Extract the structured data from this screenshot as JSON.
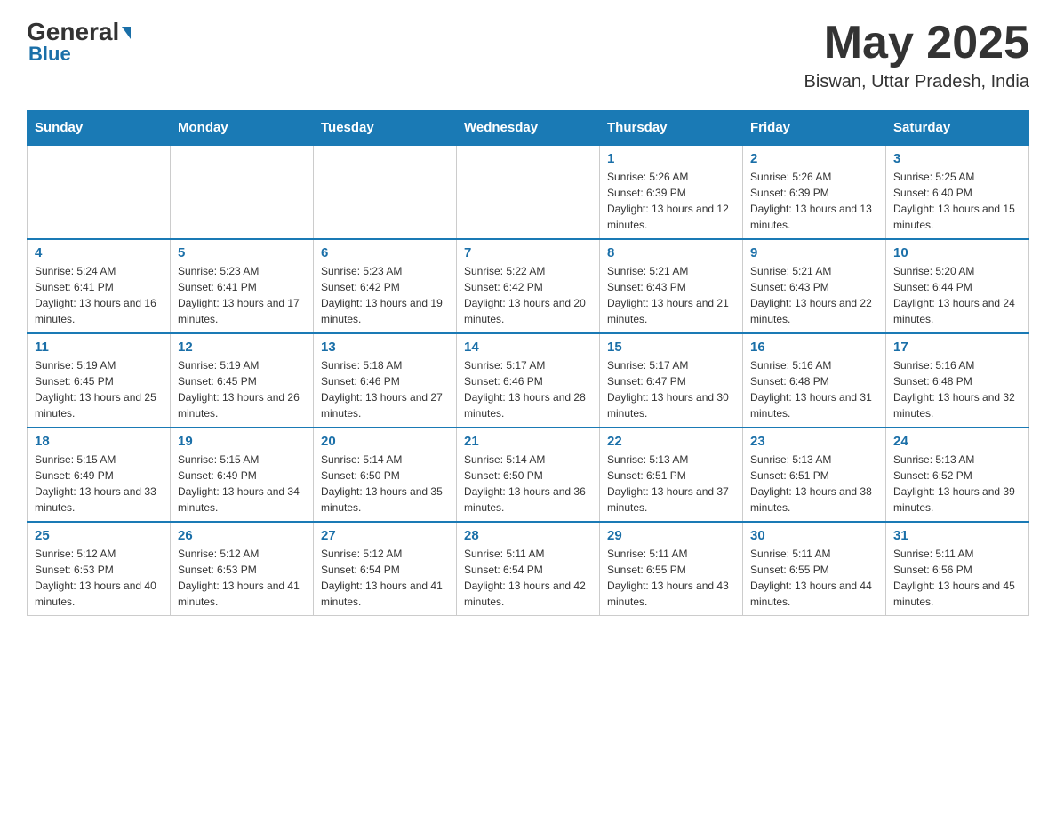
{
  "header": {
    "logo_general": "General",
    "logo_blue": "Blue",
    "title": "May 2025",
    "location": "Biswan, Uttar Pradesh, India"
  },
  "weekdays": [
    "Sunday",
    "Monday",
    "Tuesday",
    "Wednesday",
    "Thursday",
    "Friday",
    "Saturday"
  ],
  "weeks": [
    [
      {
        "day": "",
        "info": ""
      },
      {
        "day": "",
        "info": ""
      },
      {
        "day": "",
        "info": ""
      },
      {
        "day": "",
        "info": ""
      },
      {
        "day": "1",
        "info": "Sunrise: 5:26 AM\nSunset: 6:39 PM\nDaylight: 13 hours and 12 minutes."
      },
      {
        "day": "2",
        "info": "Sunrise: 5:26 AM\nSunset: 6:39 PM\nDaylight: 13 hours and 13 minutes."
      },
      {
        "day": "3",
        "info": "Sunrise: 5:25 AM\nSunset: 6:40 PM\nDaylight: 13 hours and 15 minutes."
      }
    ],
    [
      {
        "day": "4",
        "info": "Sunrise: 5:24 AM\nSunset: 6:41 PM\nDaylight: 13 hours and 16 minutes."
      },
      {
        "day": "5",
        "info": "Sunrise: 5:23 AM\nSunset: 6:41 PM\nDaylight: 13 hours and 17 minutes."
      },
      {
        "day": "6",
        "info": "Sunrise: 5:23 AM\nSunset: 6:42 PM\nDaylight: 13 hours and 19 minutes."
      },
      {
        "day": "7",
        "info": "Sunrise: 5:22 AM\nSunset: 6:42 PM\nDaylight: 13 hours and 20 minutes."
      },
      {
        "day": "8",
        "info": "Sunrise: 5:21 AM\nSunset: 6:43 PM\nDaylight: 13 hours and 21 minutes."
      },
      {
        "day": "9",
        "info": "Sunrise: 5:21 AM\nSunset: 6:43 PM\nDaylight: 13 hours and 22 minutes."
      },
      {
        "day": "10",
        "info": "Sunrise: 5:20 AM\nSunset: 6:44 PM\nDaylight: 13 hours and 24 minutes."
      }
    ],
    [
      {
        "day": "11",
        "info": "Sunrise: 5:19 AM\nSunset: 6:45 PM\nDaylight: 13 hours and 25 minutes."
      },
      {
        "day": "12",
        "info": "Sunrise: 5:19 AM\nSunset: 6:45 PM\nDaylight: 13 hours and 26 minutes."
      },
      {
        "day": "13",
        "info": "Sunrise: 5:18 AM\nSunset: 6:46 PM\nDaylight: 13 hours and 27 minutes."
      },
      {
        "day": "14",
        "info": "Sunrise: 5:17 AM\nSunset: 6:46 PM\nDaylight: 13 hours and 28 minutes."
      },
      {
        "day": "15",
        "info": "Sunrise: 5:17 AM\nSunset: 6:47 PM\nDaylight: 13 hours and 30 minutes."
      },
      {
        "day": "16",
        "info": "Sunrise: 5:16 AM\nSunset: 6:48 PM\nDaylight: 13 hours and 31 minutes."
      },
      {
        "day": "17",
        "info": "Sunrise: 5:16 AM\nSunset: 6:48 PM\nDaylight: 13 hours and 32 minutes."
      }
    ],
    [
      {
        "day": "18",
        "info": "Sunrise: 5:15 AM\nSunset: 6:49 PM\nDaylight: 13 hours and 33 minutes."
      },
      {
        "day": "19",
        "info": "Sunrise: 5:15 AM\nSunset: 6:49 PM\nDaylight: 13 hours and 34 minutes."
      },
      {
        "day": "20",
        "info": "Sunrise: 5:14 AM\nSunset: 6:50 PM\nDaylight: 13 hours and 35 minutes."
      },
      {
        "day": "21",
        "info": "Sunrise: 5:14 AM\nSunset: 6:50 PM\nDaylight: 13 hours and 36 minutes."
      },
      {
        "day": "22",
        "info": "Sunrise: 5:13 AM\nSunset: 6:51 PM\nDaylight: 13 hours and 37 minutes."
      },
      {
        "day": "23",
        "info": "Sunrise: 5:13 AM\nSunset: 6:51 PM\nDaylight: 13 hours and 38 minutes."
      },
      {
        "day": "24",
        "info": "Sunrise: 5:13 AM\nSunset: 6:52 PM\nDaylight: 13 hours and 39 minutes."
      }
    ],
    [
      {
        "day": "25",
        "info": "Sunrise: 5:12 AM\nSunset: 6:53 PM\nDaylight: 13 hours and 40 minutes."
      },
      {
        "day": "26",
        "info": "Sunrise: 5:12 AM\nSunset: 6:53 PM\nDaylight: 13 hours and 41 minutes."
      },
      {
        "day": "27",
        "info": "Sunrise: 5:12 AM\nSunset: 6:54 PM\nDaylight: 13 hours and 41 minutes."
      },
      {
        "day": "28",
        "info": "Sunrise: 5:11 AM\nSunset: 6:54 PM\nDaylight: 13 hours and 42 minutes."
      },
      {
        "day": "29",
        "info": "Sunrise: 5:11 AM\nSunset: 6:55 PM\nDaylight: 13 hours and 43 minutes."
      },
      {
        "day": "30",
        "info": "Sunrise: 5:11 AM\nSunset: 6:55 PM\nDaylight: 13 hours and 44 minutes."
      },
      {
        "day": "31",
        "info": "Sunrise: 5:11 AM\nSunset: 6:56 PM\nDaylight: 13 hours and 45 minutes."
      }
    ]
  ]
}
